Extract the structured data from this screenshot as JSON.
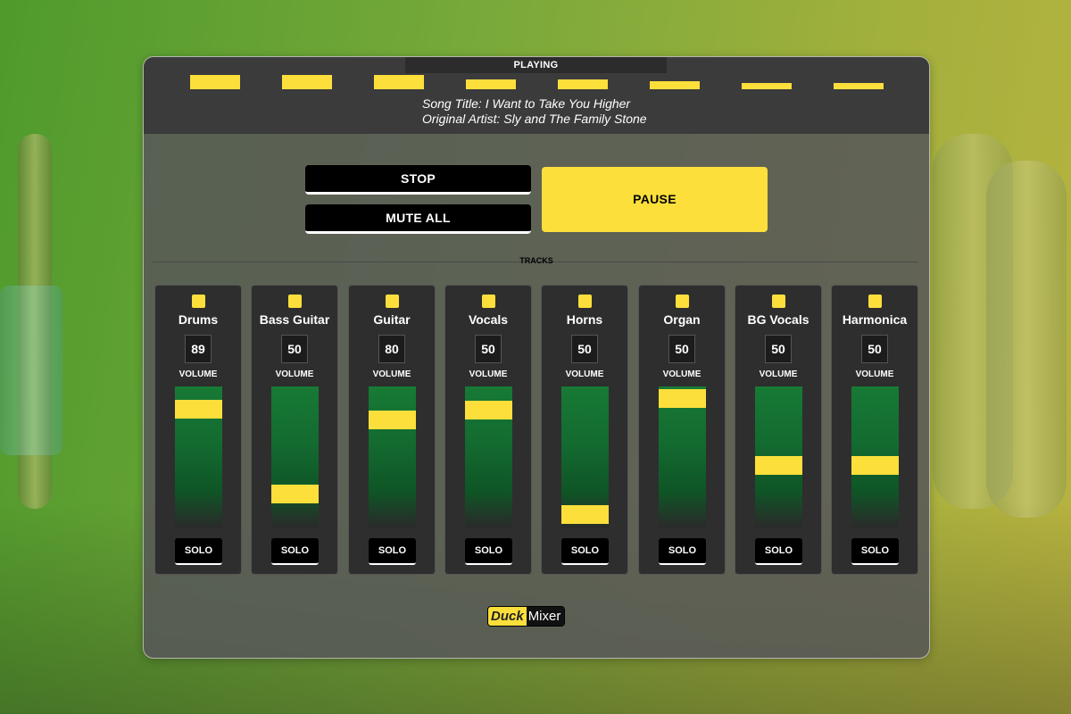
{
  "status": {
    "label": "PLAYING",
    "level_meters": [
      1,
      1,
      1,
      0.7,
      0.7,
      0.55,
      0.45,
      0.45
    ]
  },
  "song": {
    "title_line": "Song Title: I Want to Take You Higher",
    "artist_line": "Original Artist: Sly and The Family Stone"
  },
  "controls": {
    "stop_label": "STOP",
    "mute_all_label": "MUTE ALL",
    "pause_label": "PAUSE"
  },
  "tracks_heading": "TRACKS",
  "tracks": [
    {
      "name": "Drums",
      "volume": "89",
      "volume_label": "VOLUME",
      "solo_label": "SOLO",
      "fader_level": 0.89
    },
    {
      "name": "Bass Guitar",
      "volume": "50",
      "volume_label": "VOLUME",
      "solo_label": "SOLO",
      "fader_level": 0.2
    },
    {
      "name": "Guitar",
      "volume": "80",
      "volume_label": "VOLUME",
      "solo_label": "SOLO",
      "fader_level": 0.8
    },
    {
      "name": "Vocals",
      "volume": "50",
      "volume_label": "VOLUME",
      "solo_label": "SOLO",
      "fader_level": 0.88
    },
    {
      "name": "Horns",
      "volume": "50",
      "volume_label": "VOLUME",
      "solo_label": "SOLO",
      "fader_level": 0.03
    },
    {
      "name": "Organ",
      "volume": "50",
      "volume_label": "VOLUME",
      "solo_label": "SOLO",
      "fader_level": 0.98
    },
    {
      "name": "BG Vocals",
      "volume": "50",
      "volume_label": "VOLUME",
      "solo_label": "SOLO",
      "fader_level": 0.43
    },
    {
      "name": "Harmonica",
      "volume": "50",
      "volume_label": "VOLUME",
      "solo_label": "SOLO",
      "fader_level": 0.43
    }
  ],
  "logo": {
    "part1": "Duck",
    "part2": "Mixer"
  },
  "colors": {
    "accent": "#fddf3c",
    "fader_green": "#177a35",
    "panel": "#2e2e2e"
  }
}
